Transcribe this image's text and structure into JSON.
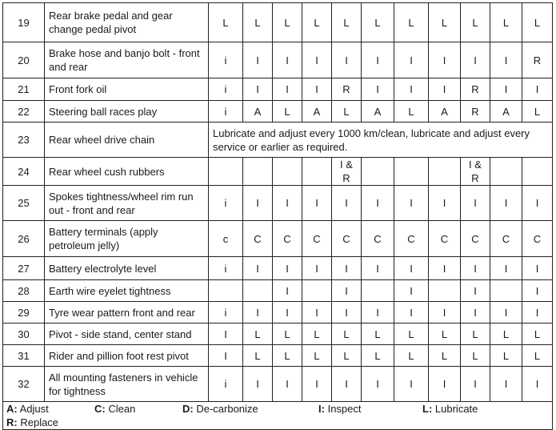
{
  "rows": [
    {
      "no": "19",
      "desc": "Rear brake pedal and gear change pedal pivot",
      "cells": [
        "L",
        "L",
        "L",
        "L",
        "L",
        "L",
        "L",
        "L",
        "L",
        "L",
        "L"
      ],
      "h": 49
    },
    {
      "no": "20",
      "desc": "Brake hose and banjo bolt - front and rear",
      "cells": [
        "i",
        "I",
        "I",
        "I",
        "I",
        "I",
        "I",
        "I",
        "I",
        "I",
        "R"
      ],
      "h": 45
    },
    {
      "no": "21",
      "desc": "Front fork oil",
      "cells": [
        "i",
        "I",
        "I",
        "I",
        "R",
        "I",
        "I",
        "I",
        "R",
        "I",
        "I"
      ],
      "h": 28
    },
    {
      "no": "22",
      "desc": "Steering ball races play",
      "cells": [
        "i",
        "A",
        "L",
        "A",
        "L",
        "A",
        "L",
        "A",
        "R",
        "A",
        "L"
      ],
      "h": 27
    },
    {
      "no": "23",
      "desc": "Rear wheel drive chain",
      "note": "Lubricate and adjust every 1000 km/clean, lubricate and adjust every service or earlier as required.",
      "h": 44
    },
    {
      "no": "24",
      "desc": "Rear wheel cush rubbers",
      "cells": [
        "",
        "",
        "",
        "",
        "I & R",
        "",
        "",
        "",
        "I & R",
        "",
        ""
      ],
      "h": 28
    },
    {
      "no": "25",
      "desc": "Spokes tightness/wheel rim run out - front and rear",
      "cells": [
        "i",
        "I",
        "I",
        "I",
        "I",
        "I",
        "I",
        "I",
        "I",
        "I",
        "I"
      ],
      "h": 44
    },
    {
      "no": "26",
      "desc": "Battery terminals (apply petroleum jelly)",
      "cells": [
        "c",
        "C",
        "C",
        "C",
        "C",
        "C",
        "C",
        "C",
        "C",
        "C",
        "C"
      ],
      "h": 45
    },
    {
      "no": "27",
      "desc": "Battery electrolyte level",
      "cells": [
        "i",
        "I",
        "I",
        "I",
        "I",
        "I",
        "I",
        "I",
        "I",
        "I",
        "I"
      ],
      "h": 29
    },
    {
      "no": "28",
      "desc": "Earth wire eyelet tightness",
      "cells": [
        "",
        "",
        "I",
        "",
        "I",
        "",
        "I",
        "",
        "I",
        "",
        "I"
      ],
      "h": 27
    },
    {
      "no": "29",
      "desc": "Tyre wear pattern front and rear",
      "cells": [
        "i",
        "I",
        "I",
        "I",
        "I",
        "I",
        "I",
        "I",
        "I",
        "I",
        "I"
      ],
      "h": 27
    },
    {
      "no": "30",
      "desc": "Pivot - side stand, center stand",
      "cells": [
        "I",
        "L",
        "L",
        "L",
        "L",
        "L",
        "L",
        "L",
        "L",
        "L",
        "L"
      ],
      "h": 27
    },
    {
      "no": "31",
      "desc": "Rider and pillion foot rest pivot",
      "cells": [
        "I",
        "L",
        "L",
        "L",
        "L",
        "L",
        "L",
        "L",
        "L",
        "L",
        "L"
      ],
      "h": 27
    },
    {
      "no": "32",
      "desc": "All mounting fasteners in vehicle for tightness",
      "cells": [
        "i",
        "I",
        "I",
        "I",
        "I",
        "I",
        "I",
        "I",
        "I",
        "I",
        "I"
      ],
      "h": 44
    }
  ],
  "legend": [
    {
      "key": "A:",
      "label": "Adjust"
    },
    {
      "key": "C:",
      "label": "Clean"
    },
    {
      "key": "D:",
      "label": "De-carbonize"
    },
    {
      "key": "I:",
      "label": "Inspect"
    },
    {
      "key": "L:",
      "label": "Lubricate"
    },
    {
      "key": "R:",
      "label": "Replace"
    }
  ]
}
